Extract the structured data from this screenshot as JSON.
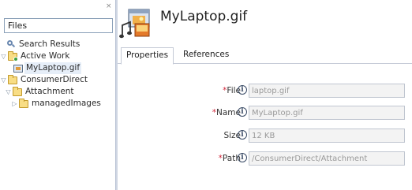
{
  "navigator": {
    "close_glyph": "×",
    "search_value": "Files",
    "tree": [
      {
        "label": "Search Results",
        "icon": "search-icon"
      },
      {
        "label": "Active Work",
        "icon": "folder-icon"
      },
      {
        "label": "MyLaptop.gif",
        "icon": "gif-file-icon"
      },
      {
        "label": "ConsumerDirect",
        "icon": "folder-icon"
      },
      {
        "label": "Attachment",
        "icon": "folder-icon"
      },
      {
        "label": "managedImages",
        "icon": "folder-icon"
      }
    ]
  },
  "editor": {
    "title": "MyLaptop.gif",
    "tabs": [
      {
        "label": "Properties"
      },
      {
        "label": "References"
      }
    ],
    "info_glyph": "i",
    "fields": [
      {
        "label": "File",
        "required": "*",
        "value": "laptop.gif"
      },
      {
        "label": "Name",
        "required": "*",
        "value": "MyLaptop.gif"
      },
      {
        "label": "Size",
        "value": "12 KB"
      },
      {
        "label": "Path",
        "required": "*",
        "value": "/ConsumerDirect/Attachment"
      }
    ]
  }
}
